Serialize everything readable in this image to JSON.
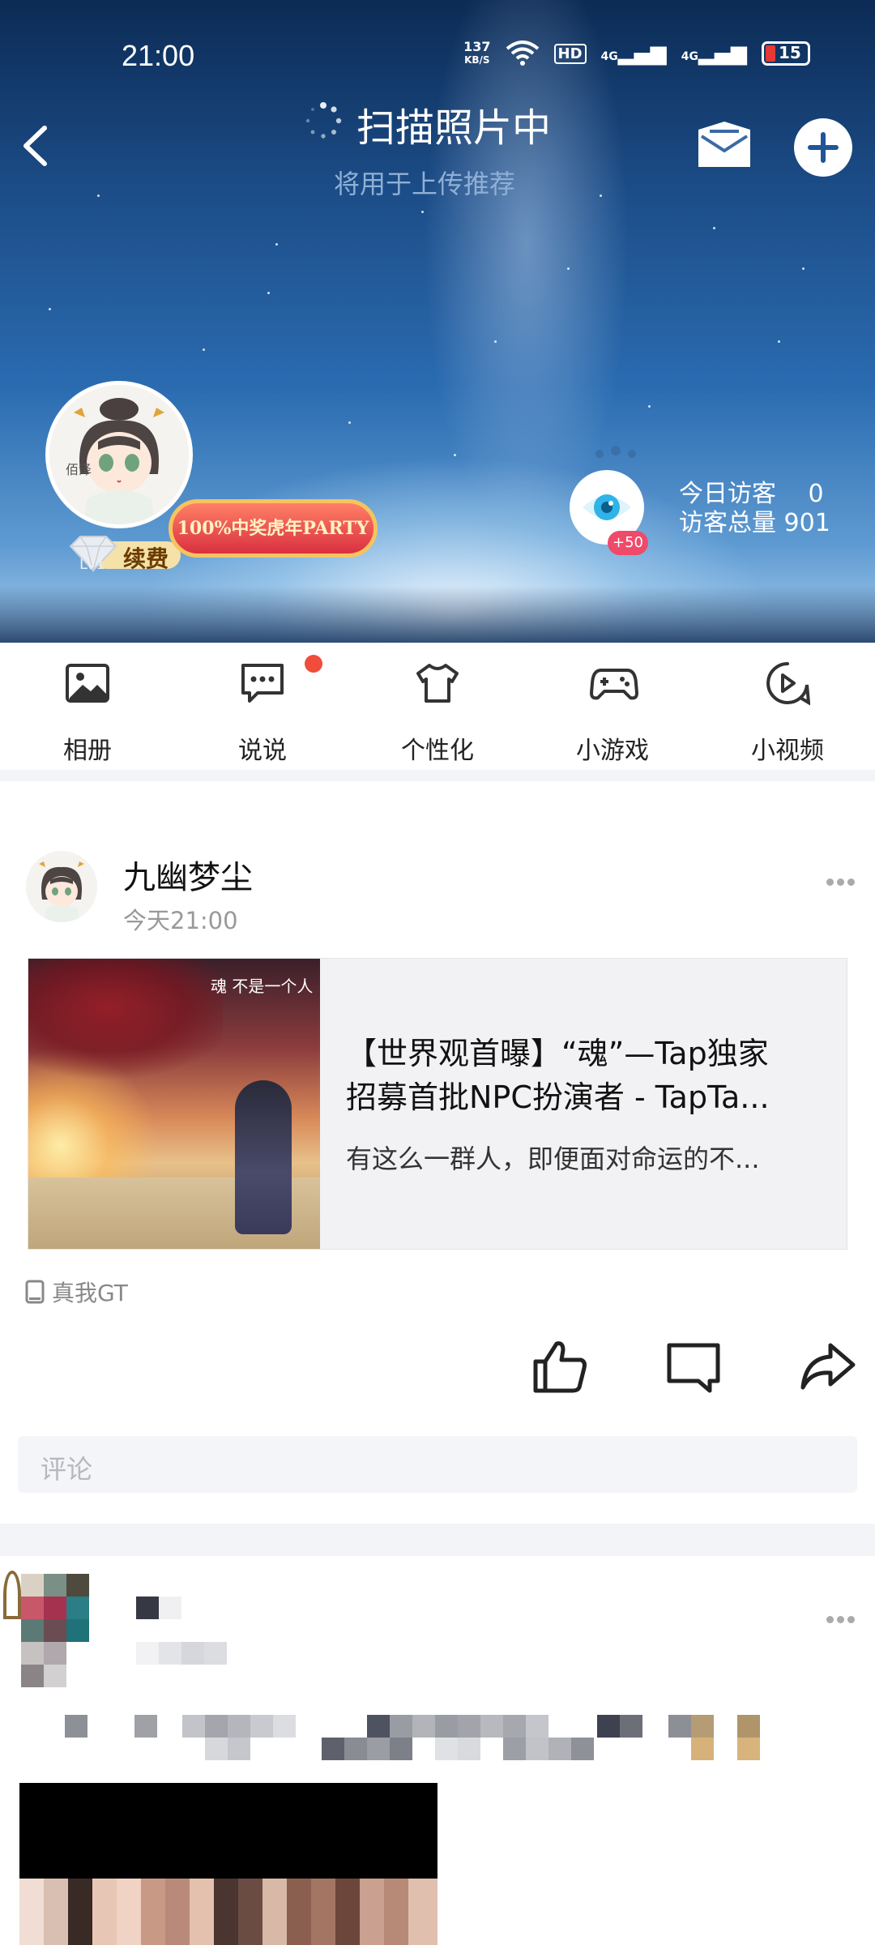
{
  "status_bar": {
    "time": "21:00",
    "net_speed_top": "137",
    "net_speed_unit": "KB/S",
    "hd_label": "HD",
    "signal1": "4G",
    "signal2": "4G",
    "battery": "15"
  },
  "header": {
    "scan_title": "扫描照片中",
    "scan_subtitle": "将用于上传推荐",
    "vip_label": "续费",
    "level_label": "LV1",
    "party_badge": "100%中奖虎年PARTY",
    "visitor_bonus": "+50",
    "visitors_today": "今日访客 　0",
    "visitors_total": "访客总量 901",
    "avatar_text": "佰泽"
  },
  "quick_nav": [
    {
      "label": "相册"
    },
    {
      "label": "说说"
    },
    {
      "label": "个性化"
    },
    {
      "label": "小游戏"
    },
    {
      "label": "小视频"
    }
  ],
  "post": {
    "author": "九幽梦尘",
    "time": "今天21:00",
    "card_title_line1": "【世界观首曝】“魂”—Tap独家",
    "card_title_line2": "招募首批NPC扮演者 - TapTa...",
    "card_desc": "有这么一群人，即便面对命运的不...",
    "image_logo": "魂 不是一个人",
    "source": "真我GT",
    "comment_placeholder": "评论"
  },
  "colors": {
    "accent_red": "#f04d3a",
    "badge_pink": "#ef4a6a",
    "separator": "#f3f4f7"
  }
}
